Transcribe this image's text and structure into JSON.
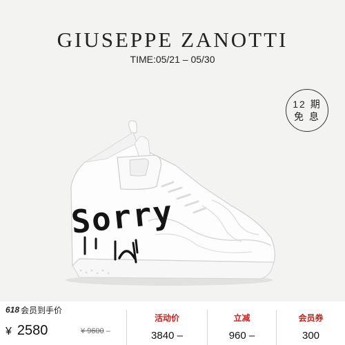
{
  "header": {
    "brand": "GIUSEPPE ZANOTTI",
    "time": "TIME:05/21 – 05/30"
  },
  "badge": {
    "line1": "12 期",
    "line2": "免 息"
  },
  "product": {
    "graffiti_text": "Sorry"
  },
  "price_bar": {
    "promo_num": "618",
    "promo_text": "会员到手价",
    "currency": "¥",
    "price": "2580",
    "orig_currency": "¥",
    "orig_price": "9600",
    "orig_suffix": "–",
    "activity_label": "活动价",
    "activity_value": "3840 –",
    "discount_label": "立减",
    "discount_value": "960 –",
    "coupon_label": "会员券",
    "coupon_value": "300"
  },
  "colors": {
    "background": "#f3f3f1",
    "accent": "#c9211e"
  }
}
